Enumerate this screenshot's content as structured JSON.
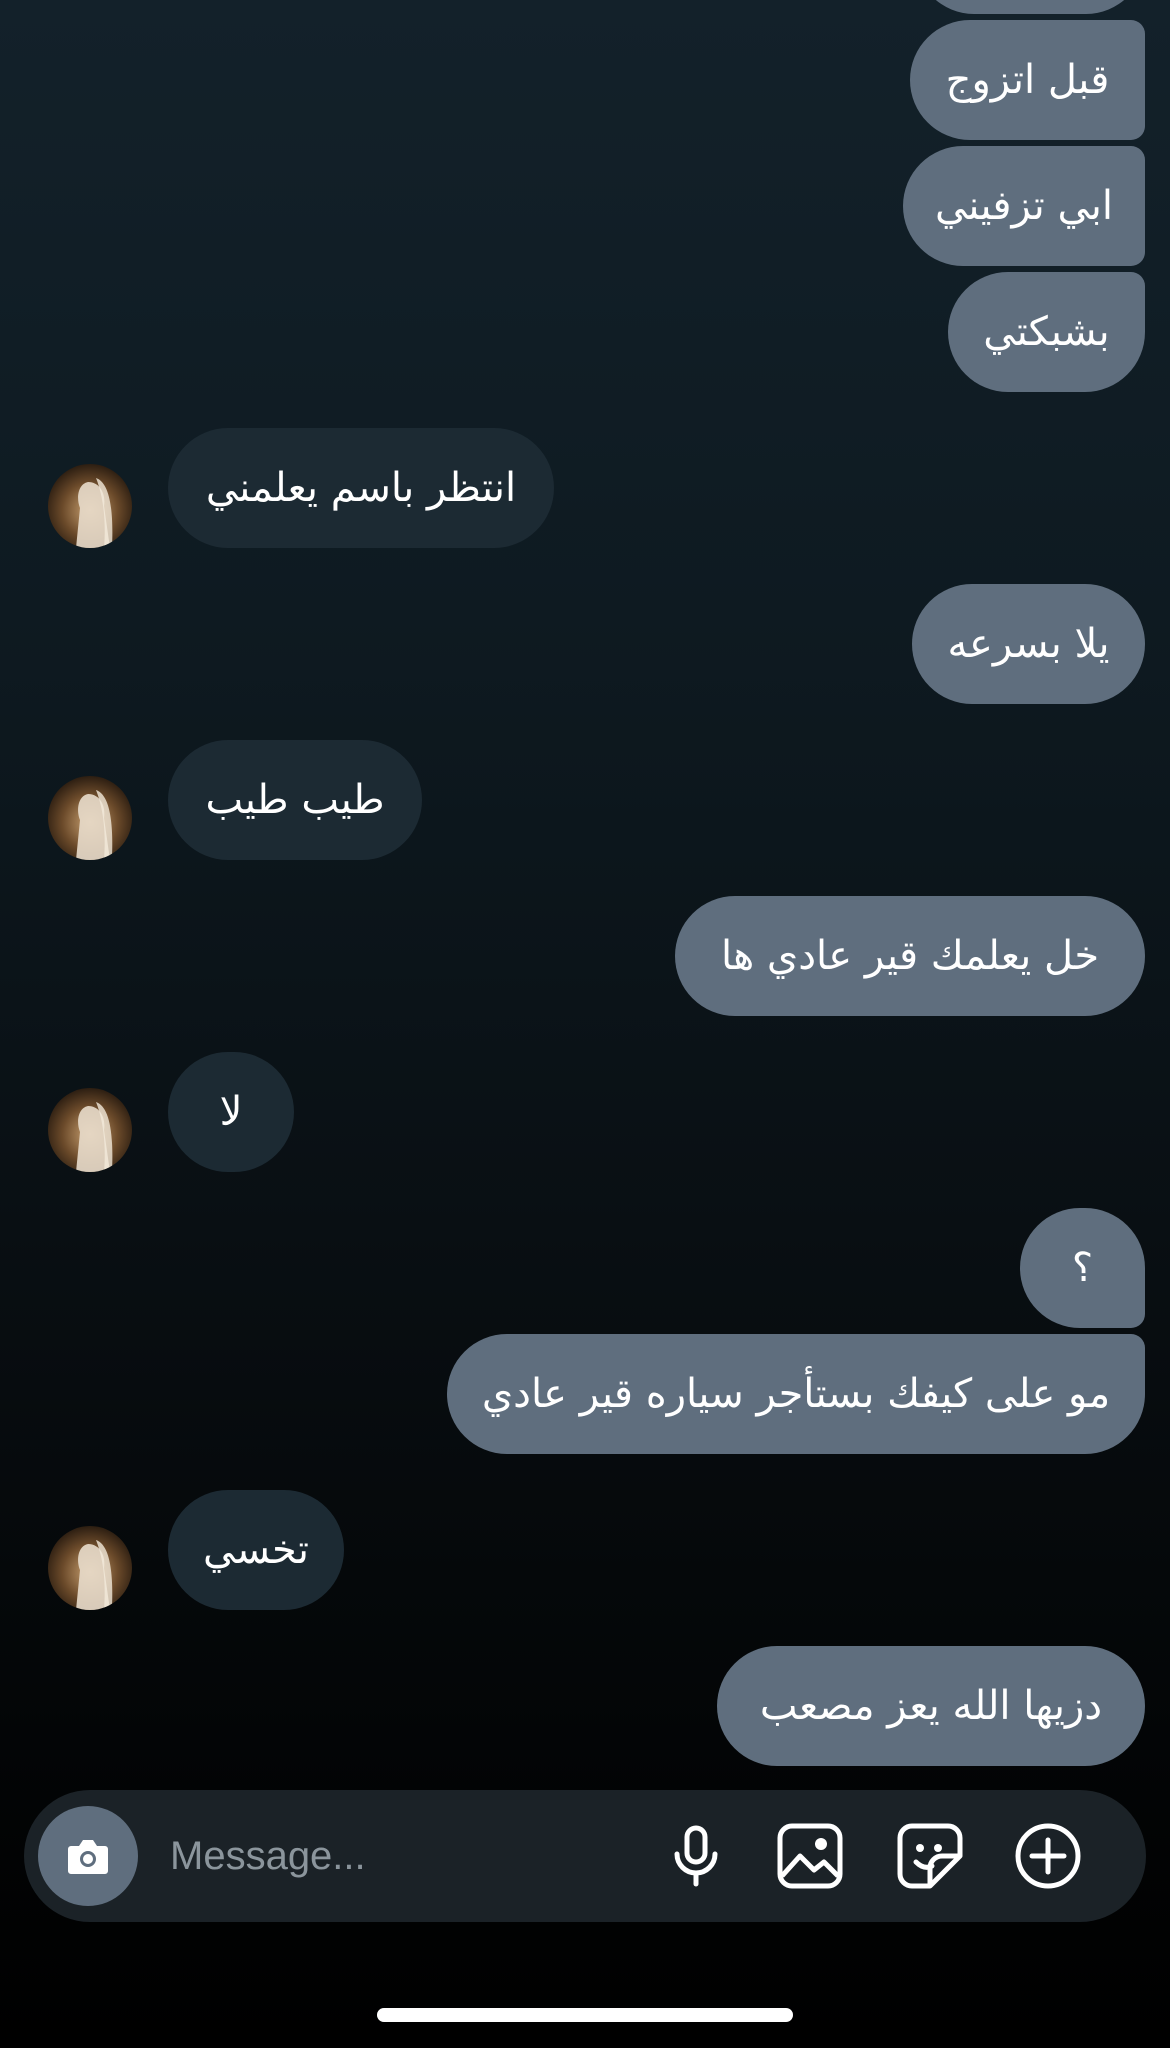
{
  "messages": [
    {
      "text": "",
      "dir": "sent"
    },
    {
      "text": "قبل اتزوج",
      "dir": "sent"
    },
    {
      "text": "ابي تزفيني",
      "dir": "sent"
    },
    {
      "text": "بشبكتي",
      "dir": "sent"
    },
    {
      "text": "انتظر باسم يعلمني",
      "dir": "received"
    },
    {
      "text": "يلا بسرعه",
      "dir": "sent"
    },
    {
      "text": "طيب طيب",
      "dir": "received"
    },
    {
      "text": "خل يعلمك قير عادي ها",
      "dir": "sent"
    },
    {
      "text": "لا",
      "dir": "received"
    },
    {
      "text": "؟",
      "dir": "sent"
    },
    {
      "text": "مو على كيفك بستأجر سياره قير عادي",
      "dir": "sent"
    },
    {
      "text": "تخسي",
      "dir": "received"
    },
    {
      "text": "دزيها الله يعز مصعب",
      "dir": "sent"
    }
  ],
  "composer": {
    "placeholder": "Message...",
    "icons": [
      "camera-icon",
      "microphone-icon",
      "gallery-icon",
      "sticker-icon",
      "plus-circle-icon"
    ]
  },
  "colors": {
    "sent_bubble": "#5f6e7e",
    "received_bubble": "#1c2a33",
    "composer_bg": "#1b2227"
  }
}
